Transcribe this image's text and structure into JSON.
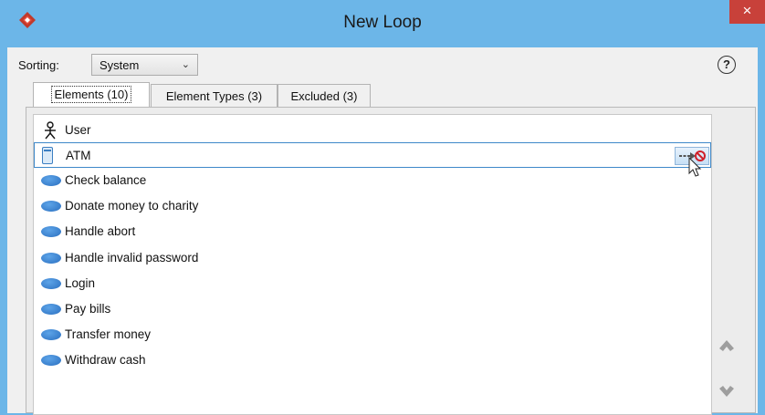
{
  "window": {
    "title": "New Loop",
    "close_glyph": "×"
  },
  "sorting": {
    "label": "Sorting:",
    "value": "System"
  },
  "help": {
    "glyph": "?"
  },
  "tabs": [
    {
      "label": "Elements (10)",
      "active": true
    },
    {
      "label": "Element Types (3)",
      "active": false
    },
    {
      "label": "Excluded (3)",
      "active": false
    }
  ],
  "elements": [
    {
      "label": "User",
      "icon": "actor-icon"
    },
    {
      "label": "ATM",
      "icon": "lifeline-icon",
      "selected": true
    },
    {
      "label": "Check balance",
      "icon": "use-case-icon"
    },
    {
      "label": "Donate money to charity",
      "icon": "use-case-icon"
    },
    {
      "label": "Handle abort",
      "icon": "use-case-icon"
    },
    {
      "label": "Handle invalid password",
      "icon": "use-case-icon"
    },
    {
      "label": "Login",
      "icon": "use-case-icon"
    },
    {
      "label": "Pay bills",
      "icon": "use-case-icon"
    },
    {
      "label": "Transfer money",
      "icon": "use-case-icon"
    },
    {
      "label": "Withdraw cash",
      "icon": "use-case-icon"
    }
  ],
  "colors": {
    "titlebar": "#6cb6e8",
    "close": "#c8413a",
    "selection": "#3e88c9",
    "use_case": "#3a86d6"
  }
}
